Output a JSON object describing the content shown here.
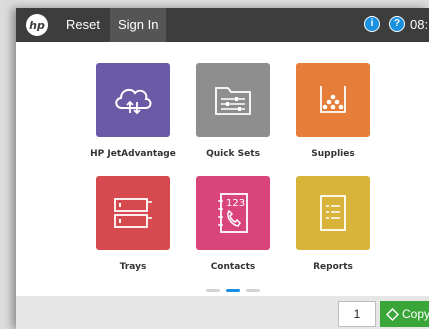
{
  "topbar": {
    "logo_text": "hp",
    "reset_label": "Reset",
    "signin_label": "Sign In",
    "info_glyph": "i",
    "help_glyph": "?",
    "time": "08:"
  },
  "apps": [
    {
      "label": "HP JetAdvantage",
      "color": "#6b5aa6",
      "icon": "cloud-icon"
    },
    {
      "label": "Quick Sets",
      "color": "#8e8e8e",
      "icon": "folder-sliders-icon"
    },
    {
      "label": "Supplies",
      "color": "#e67e3a",
      "icon": "toner-icon"
    },
    {
      "label": "Trays",
      "color": "#d64a4f",
      "icon": "trays-icon"
    },
    {
      "label": "Contacts",
      "color": "#d9457a",
      "icon": "address-book-icon"
    },
    {
      "label": "Reports",
      "color": "#d8b43a",
      "icon": "report-icon"
    }
  ],
  "contacts_icon_text": "123",
  "pager": {
    "pages": 3,
    "current": 2
  },
  "bottom": {
    "copies": "1",
    "copy_label": "Copy",
    "copy_color": "#3aa63a"
  }
}
